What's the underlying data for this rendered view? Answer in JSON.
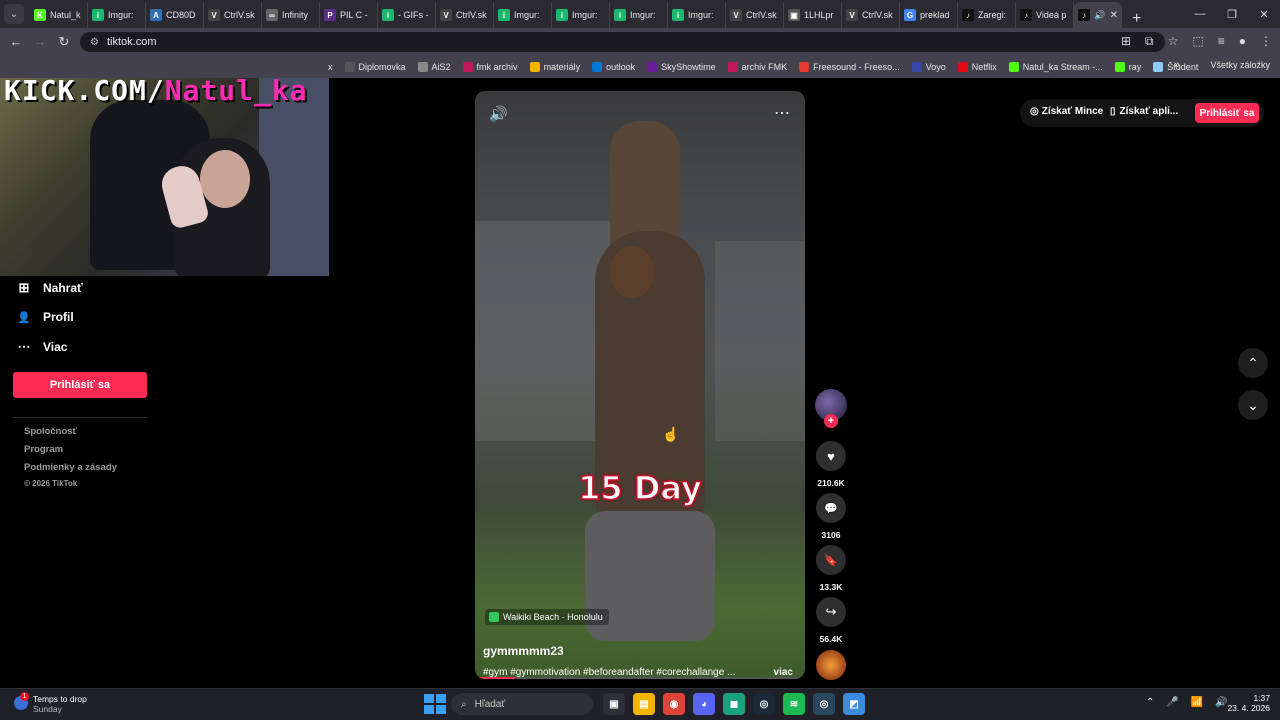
{
  "tabstrip": {
    "tabs": [
      {
        "label": "Natul_k",
        "color": "#53fc18",
        "glyph": "K"
      },
      {
        "label": "Imgur:",
        "color": "#1bb76e",
        "glyph": "i"
      },
      {
        "label": "CD80D",
        "color": "#2f6fb5",
        "glyph": "A"
      },
      {
        "label": "CtrlV.sk",
        "color": "#444444",
        "glyph": "V"
      },
      {
        "label": "Infinity",
        "color": "#666666",
        "glyph": "∞"
      },
      {
        "label": "PIL C -",
        "color": "#5b2d8a",
        "glyph": "P"
      },
      {
        "label": "- GIFs -",
        "color": "#1bb76e",
        "glyph": "i"
      },
      {
        "label": "CtrlV.sk",
        "color": "#444444",
        "glyph": "V"
      },
      {
        "label": "Imgur:",
        "color": "#1bb76e",
        "glyph": "i"
      },
      {
        "label": "Imgur:",
        "color": "#1bb76e",
        "glyph": "i"
      },
      {
        "label": "Imgur:",
        "color": "#1bb76e",
        "glyph": "i"
      },
      {
        "label": "Imgur:",
        "color": "#1bb76e",
        "glyph": "i"
      },
      {
        "label": "CtrlV.sk",
        "color": "#444444",
        "glyph": "V"
      },
      {
        "label": "1LHLpr",
        "color": "#555555",
        "glyph": "▣"
      },
      {
        "label": "CtrlV.sk",
        "color": "#444444",
        "glyph": "V"
      },
      {
        "label": "preklad",
        "color": "#4285f4",
        "glyph": "G"
      },
      {
        "label": "Zaregi:",
        "color": "#111111",
        "glyph": "♪"
      },
      {
        "label": "Videá p",
        "color": "#111111",
        "glyph": "♪"
      }
    ],
    "active_tab": {
      "label": "",
      "glyph": "♪",
      "audio_glyph": "🔊",
      "close_glyph": "✕"
    },
    "menu_glyph": "⌄",
    "new_tab_glyph": "+",
    "window_controls": {
      "minimize": "—",
      "restore": "❐",
      "close": "✕"
    }
  },
  "addressbar": {
    "back": "←",
    "forward": "→",
    "reload": "↻",
    "url": "tiktok.com",
    "site_icon": "⚙",
    "right_icons": [
      "⊞",
      "⧉",
      "☆",
      "⬚",
      "≡",
      "●",
      "⋮"
    ]
  },
  "bookmarks": {
    "items": [
      {
        "label": "x",
        "color": ""
      },
      {
        "label": "Diplomovka",
        "color": "#555555"
      },
      {
        "label": "AiS2",
        "color": "#888888"
      },
      {
        "label": "fmk archiv",
        "color": "#c2185b"
      },
      {
        "label": "materiály",
        "color": "#f4b400"
      },
      {
        "label": "outlook",
        "color": "#0078d4"
      },
      {
        "label": "SkyShowtime",
        "color": "#6a1b9a"
      },
      {
        "label": "archiv FMK",
        "color": "#c2185b"
      },
      {
        "label": "Freesound - Freeso...",
        "color": "#e53935"
      },
      {
        "label": "Voyo",
        "color": "#3949ab"
      },
      {
        "label": "Netflix",
        "color": "#e50914"
      },
      {
        "label": "Natul_ka Stream -...",
        "color": "#53fc18"
      },
      {
        "label": "ray",
        "color": "#53fc18"
      },
      {
        "label": "Študent",
        "color": "#90caf9"
      }
    ],
    "more": "»",
    "all_bookmarks": "Všetky záložky"
  },
  "webcam": {
    "overlay_prefix": "KICK.COM/",
    "overlay_name": "Natul_ka"
  },
  "sidebar": {
    "items": [
      {
        "label": "Nahrať",
        "icon": "⊞"
      },
      {
        "label": "Profil",
        "icon": "👤"
      },
      {
        "label": "Viac",
        "icon": "⋯"
      }
    ],
    "login_button": "Prihlásiť sa",
    "footer": [
      "Spoločnosť",
      "Program",
      "Podmienky a zásady",
      "© 2026 TikTok"
    ]
  },
  "video": {
    "speaker_icon": "🔊",
    "more_icon": "⋯",
    "caption": "15 Day",
    "location": "Waikiki Beach · Honolulu",
    "username": "gymmmmm23",
    "description": "#gym #gymmotivation #beforeandafter #corechallange ...",
    "more_link": "viac",
    "progress": 0.12
  },
  "actions": {
    "follow": "+",
    "like": {
      "icon": "♥",
      "count": "210.6K"
    },
    "comment": {
      "icon": "💬",
      "count": "3106"
    },
    "save": {
      "icon": "🔖",
      "count": "13.3K"
    },
    "share": {
      "icon": "↪",
      "count": "56.4K"
    }
  },
  "header": {
    "get_coins": "Získať Mince",
    "get_coins_icon": "◎",
    "get_app": "Získať apli...",
    "get_app_icon": "▯",
    "login": "Prihlásiť sa"
  },
  "nav": {
    "up": "⌃",
    "down": "⌄"
  },
  "taskbar": {
    "weather_title": "Temps to drop",
    "weather_sub": "Sunday",
    "weather_badge": "1",
    "search_placeholder": "Hľadať",
    "search_icon": "⌕",
    "apps": [
      {
        "name": "task-view",
        "color": "#2e2f38",
        "glyph": "▣"
      },
      {
        "name": "file-explorer",
        "color": "#f4b400",
        "glyph": "▤"
      },
      {
        "name": "chrome",
        "color": "#db4437",
        "glyph": "◉"
      },
      {
        "name": "discord",
        "color": "#5865f2",
        "glyph": "◕"
      },
      {
        "name": "app-green",
        "color": "#1aa37a",
        "glyph": "◼"
      },
      {
        "name": "steam",
        "color": "#1b2838",
        "glyph": "◎"
      },
      {
        "name": "spotify",
        "color": "#1db954",
        "glyph": "≋"
      },
      {
        "name": "steam-active",
        "color": "#2a475e",
        "glyph": "◎"
      },
      {
        "name": "app-blue",
        "color": "#3a8dde",
        "glyph": "◩"
      }
    ],
    "tray": [
      "⌃",
      "🎤",
      "📶",
      "🔊"
    ],
    "time": "1:37",
    "date": "23. 4. 2026"
  }
}
